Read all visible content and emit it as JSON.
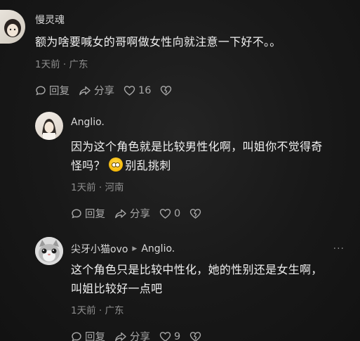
{
  "comments": [
    {
      "author": "慢灵魂",
      "text": "额为啥要喊女的哥啊做女性向就注意一下好不。。",
      "meta": "1天前 · 广东",
      "reply_label": "回复",
      "share_label": "分享",
      "likes": "16"
    },
    {
      "author": "Anglio.",
      "text_line1": "因为这个角色就是比较男性化啊，叫姐你不觉得奇",
      "text_line2_a": "怪吗？",
      "text_line2_b": "别乱挑刺",
      "meta": "1天前 · 河南",
      "reply_label": "回复",
      "share_label": "分享",
      "likes": "0"
    },
    {
      "author": "尖牙小猫ovo",
      "reply_to": "Anglio.",
      "text_line1": "这个角色只是比较中性化，她的性别还是女生啊，",
      "text_line2": "叫姐比较好一点吧",
      "meta": "1天前 · 广东",
      "reply_label": "回复",
      "share_label": "分享",
      "likes": "9",
      "more": "···"
    }
  ],
  "icons": [
    "comment-icon",
    "share-icon",
    "heart-icon",
    "dislike-heart-icon",
    "emoji-icon"
  ]
}
